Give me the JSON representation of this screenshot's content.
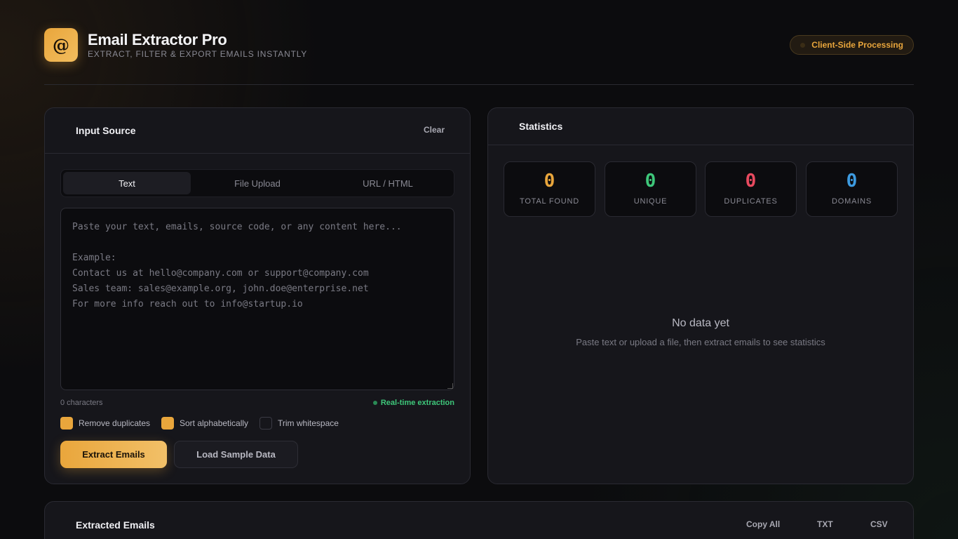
{
  "header": {
    "logo_glyph": "@",
    "title": "Email Extractor Pro",
    "subtitle": "EXTRACT, FILTER & EXPORT EMAILS INSTANTLY",
    "badge": "Client-Side Processing"
  },
  "input": {
    "title": "Input Source",
    "clear_label": "Clear",
    "tabs": [
      {
        "label": "Text",
        "active": true
      },
      {
        "label": "File Upload",
        "active": false
      },
      {
        "label": "URL / HTML",
        "active": false
      }
    ],
    "placeholder": "Paste your text, emails, source code, or any content here...\n\nExample:\nContact us at hello@company.com or support@company.com\nSales team: sales@example.org, john.doe@enterprise.net\nFor more info reach out to info@startup.io",
    "char_count": "0 characters",
    "realtime_label": "Real-time extraction",
    "options": [
      {
        "label": "Remove duplicates",
        "checked": true
      },
      {
        "label": "Sort alphabetically",
        "checked": true
      },
      {
        "label": "Trim whitespace",
        "checked": false
      }
    ],
    "extract_label": "Extract Emails",
    "sample_label": "Load Sample Data"
  },
  "stats": {
    "title": "Statistics",
    "cards": [
      {
        "value": "0",
        "label": "TOTAL FOUND",
        "color": "#e9a63c"
      },
      {
        "value": "0",
        "label": "UNIQUE",
        "color": "#3ec77a"
      },
      {
        "value": "0",
        "label": "DUPLICATES",
        "color": "#e84a5f"
      },
      {
        "value": "0",
        "label": "DOMAINS",
        "color": "#3d9be0"
      }
    ],
    "empty_title": "No data yet",
    "empty_sub": "Paste text or upload a file, then extract emails to see statistics"
  },
  "extracted": {
    "title": "Extracted Emails",
    "copy_all": "Copy All",
    "txt": "TXT",
    "csv": "CSV"
  }
}
